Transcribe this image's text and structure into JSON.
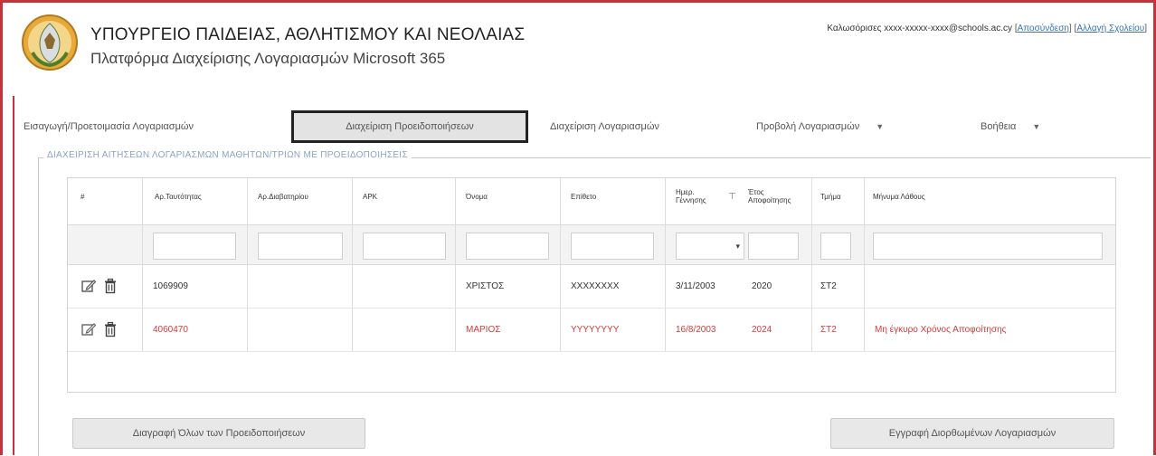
{
  "header": {
    "ministry_title": "ΥΠΟΥΡΓΕΙΟ ΠΑΙΔΕΙΑΣ, ΑΘΛΗΤΙΣΜΟΥ ΚΑΙ ΝΕΟΛΑΙΑΣ",
    "platform_subtitle": "Πλατφόρμα Διαχείρισης Λογαριασμών Microsoft 365",
    "user_prefix": "Καλωσόρισες ",
    "user_email": "xxxx-xxxxx-xxxx@schools.ac.cy",
    "logout_label": "Αποσύνδεση",
    "change_school_label": "Αλλαγή Σχολείου"
  },
  "nav": {
    "items": [
      {
        "label": "Εισαγωγή/Προετοιμασία Λογαριασμών"
      },
      {
        "label": "Διαχείριση Προειδοποιήσεων"
      },
      {
        "label": "Διαχείριση Λογαριασμών"
      },
      {
        "label": "Προβολή Λογαριασμών"
      },
      {
        "label": "Βοήθεια"
      }
    ],
    "dropdown_caret": "▼"
  },
  "section": {
    "legend": "ΔΙΑΧΕΙΡΙΣΗ ΑΙΤΗΣΕΩΝ ΛΟΓΑΡΙΑΣΜΩΝ ΜΑΘΗΤΩΝ/ΤΡΙΩΝ ΜΕ ΠΡΟΕΙΔΟΠΟΙΗΣΕΙΣ"
  },
  "grid": {
    "columns": [
      "#",
      "Αρ.Ταυτότητας",
      "Αρ.Διαβατηρίου",
      "ΑΡΚ",
      "Όνομα",
      "Επίθετο",
      "Ημερ. Γέννησης",
      "Έτος Αποφοίτησης",
      "Τμήμα",
      "Μήνυμα Λάθους"
    ],
    "filter_icon": "⊤",
    "select_arrow": "▾",
    "rows": [
      {
        "id_number": "1069909",
        "passport": "",
        "ark": "",
        "first_name": "ΧΡΙΣΤΟΣ",
        "last_name": "XXXXXXXX",
        "birth_date": "3/11/2003",
        "grad_year": "2020",
        "class": "ΣΤ2",
        "error_message": "",
        "status": "normal"
      },
      {
        "id_number": "4060470",
        "passport": "",
        "ark": "",
        "first_name": "ΜΑΡΙΟΣ",
        "last_name": "YYYYYYYY",
        "birth_date": "16/8/2003",
        "grad_year": "2024",
        "class": "ΣΤ2",
        "error_message": "Μη έγκυρο Χρόνος Αποφοίτησης",
        "status": "error"
      }
    ]
  },
  "buttons": {
    "left": "Διαγραφή Όλων των Προειδοποιήσεων",
    "right": "Εγγραφή Διορθωμένων Λογαριασμών"
  },
  "colors": {
    "frame": "#c4323b",
    "error_text": "#d33a3a",
    "link": "#3a73b8"
  }
}
